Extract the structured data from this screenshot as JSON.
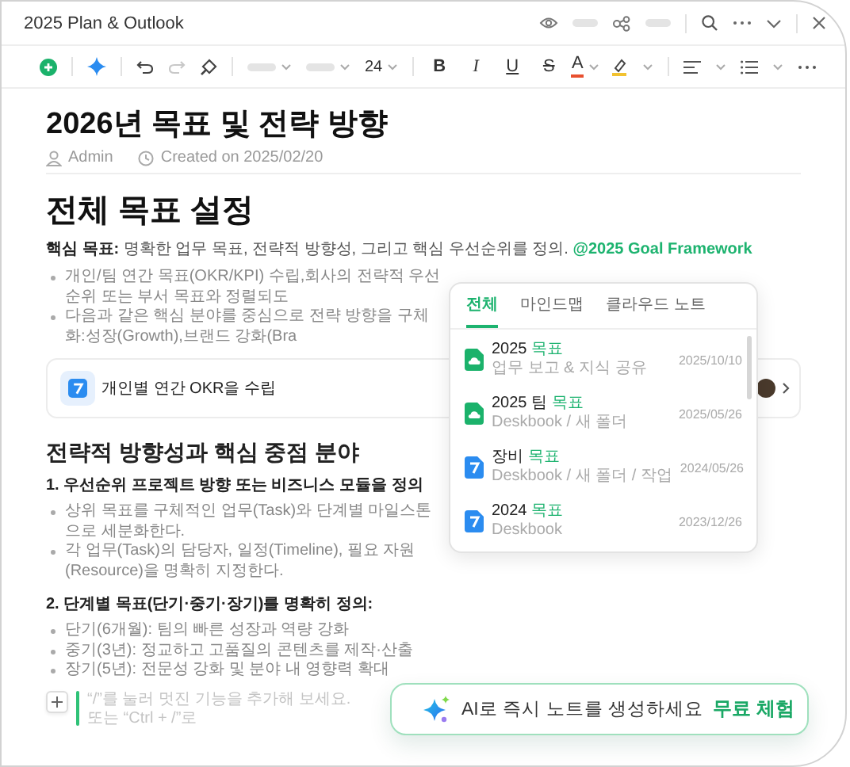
{
  "window": {
    "title": "2025 Plan & Outlook"
  },
  "toolbar": {
    "redo_disabled": true,
    "font_size": "24",
    "format_buttons": [
      {
        "label": "B",
        "kind": "bold"
      },
      {
        "label": "I",
        "kind": "italic"
      },
      {
        "label": "U",
        "kind": "underline"
      },
      {
        "label": "S",
        "kind": "strike"
      },
      {
        "label": "A",
        "kind": "color"
      }
    ]
  },
  "document": {
    "title": "2026년 목표 및 전략 방향",
    "author": "Admin",
    "created": "Created on 2025/02/20",
    "blocks": [
      {
        "kind": "h2",
        "text": "전체 목표 설정"
      },
      {
        "kind": "lead",
        "label": "핵심 목표:",
        "text": "명확한 업무 목표, 전략적 방향성, 그리고 핵심 우선순위를 정의.",
        "mention": "@2025 Goal Framework"
      },
      {
        "kind": "bullets",
        "items": [
          "개인/팀 연간 목표(OKR/KPI) 수립,회사의 전략적 우선순위 또는 부서 목표와 정렬되도",
          "다음과 같은 핵심 분야를 중심으로 전략 방향을 구체화:성장(Growth),브랜드 강화(Bra"
        ]
      },
      {
        "kind": "card",
        "text": "개인별 연간 OKR을 수립"
      },
      {
        "kind": "h3",
        "text": "전략적 방향성과 핵심 중점 분야"
      },
      {
        "kind": "h4",
        "text": "1. 우선순위 프로젝트 방향 또는 비즈니스 모듈을 정의"
      },
      {
        "kind": "bullets",
        "items": [
          "상위 목표를 구체적인 업무(Task)와 단계별 마일스톤으로 세분화한다.",
          "각 업무(Task)의 담당자, 일정(Timeline), 필요 자원(Resource)을 명확히 지정한다."
        ]
      },
      {
        "kind": "h4",
        "text": "2. 단계별 목표(단기·중기·장기)를 명확히 정의:"
      },
      {
        "kind": "bullets",
        "items": [
          "단기(6개월): 팀의 빠른 성장과 역량 강화",
          "중기(3년): 정교하고 고품질의 콘텐츠를 제작·산출",
          "장기(5년): 전문성 강화 및 분야 내 영향력 확대"
        ]
      }
    ],
    "placeholder": "“/”를 눌러 멋진 기능을 추가해 보세요.또는 “Ctrl + /”로"
  },
  "popup": {
    "tabs": [
      {
        "label": "전체",
        "selected": true
      },
      {
        "label": "마인드맵",
        "selected": false
      },
      {
        "label": "클라우드 노트",
        "selected": false
      }
    ],
    "items": [
      {
        "kind": "cloud",
        "title_parts": [
          {
            "text": "2025 ",
            "match": false
          },
          {
            "text": "목표",
            "match": true
          }
        ],
        "path": "업무 보고 & 지식 공유",
        "date": "2025/10/10"
      },
      {
        "kind": "cloud",
        "title_parts": [
          {
            "text": "2025 팀 ",
            "match": false
          },
          {
            "text": "목표",
            "match": true
          }
        ],
        "path": "Deskbook / 새 폴더",
        "date": "2025/05/26"
      },
      {
        "kind": "doc",
        "title_parts": [
          {
            "text": "장비 ",
            "match": false
          },
          {
            "text": "목표",
            "match": true
          }
        ],
        "path": "Deskbook / 새 폴더 / 작업",
        "date": "2024/05/26"
      },
      {
        "kind": "doc",
        "title_parts": [
          {
            "text": "2024 ",
            "match": false
          },
          {
            "text": "목표",
            "match": true
          }
        ],
        "path": "Deskbook",
        "date": "2023/12/26"
      }
    ]
  },
  "banner": {
    "text": "AI로 즉시 노트를 생성하세요",
    "action": "무료 체험"
  }
}
